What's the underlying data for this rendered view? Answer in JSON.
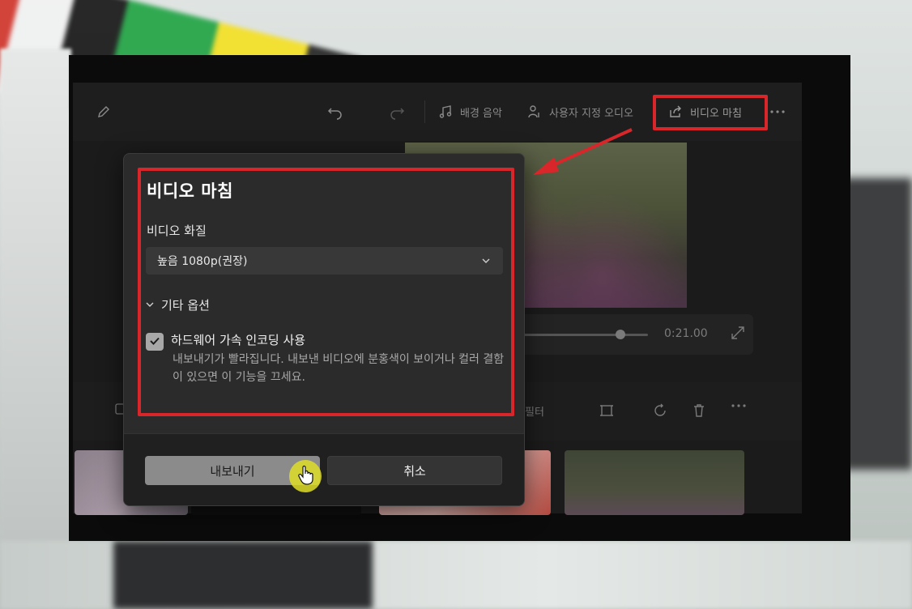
{
  "toolbar": {
    "bg_music_label": "배경 음악",
    "custom_audio_label": "사용자 지정 오디오",
    "finish_video_label": "비디오 마침"
  },
  "player": {
    "time": "0:21.00"
  },
  "timeline": {
    "filter_label": "필터"
  },
  "dialog": {
    "title": "비디오 마침",
    "quality_label": "비디오 화질",
    "quality_value": "높음 1080p(권장)",
    "more_options_label": "기타 옵션",
    "hw_encoding_label": "하드웨어 가속 인코딩 사용",
    "hw_encoding_desc": "내보내기가 빨라집니다. 내보낸 비디오에 분홍색이 보이거나 컬러 결함이 있으면 이 기능을 끄세요.",
    "hw_encoding_checked": true,
    "export_label": "내보내기",
    "cancel_label": "취소"
  },
  "colors": {
    "highlight": "#d8262a",
    "cursor_ring": "#dede28",
    "dialog_bg": "#2b2b2b"
  },
  "icons": [
    "pencil-icon",
    "undo-icon",
    "redo-icon",
    "music-note-icon",
    "person-audio-icon",
    "share-icon",
    "more-icon",
    "chevron-down-icon",
    "checkmark-icon",
    "fullscreen-icon",
    "crop-icon",
    "rotate-icon",
    "trash-icon",
    "hand-cursor-icon"
  ]
}
